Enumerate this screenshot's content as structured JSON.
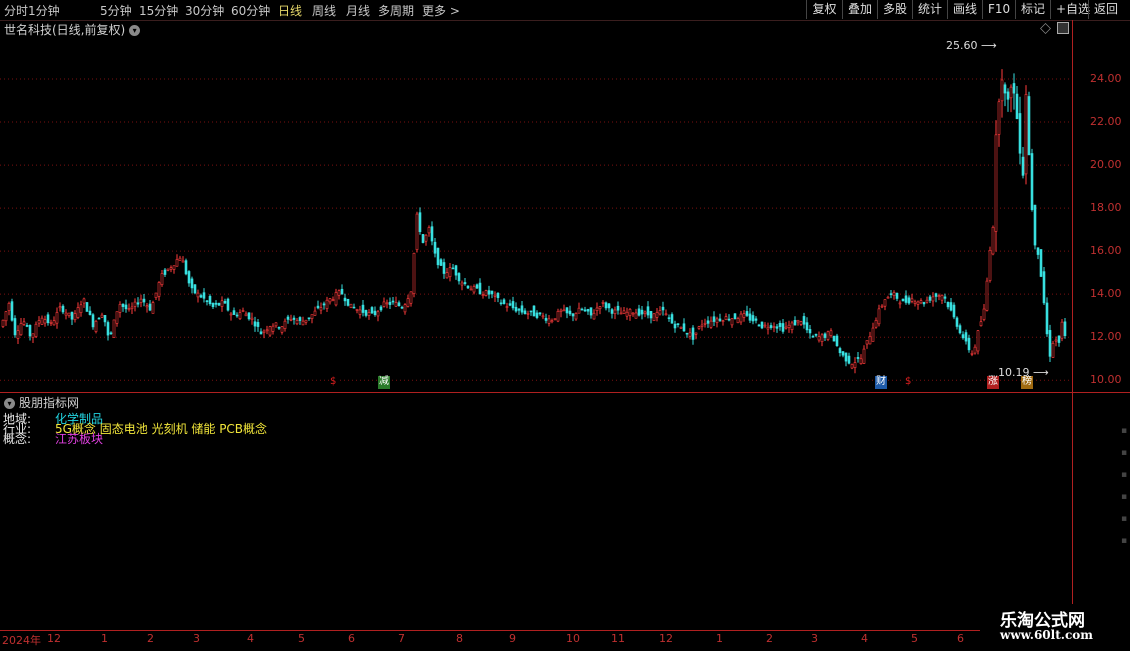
{
  "toolbar": {
    "periods": [
      "分时",
      "1分钟",
      "5分钟",
      "15分钟",
      "30分钟",
      "60分钟",
      "日线",
      "周线",
      "月线",
      "多周期",
      "更多 >"
    ],
    "active_period": "日线",
    "right_buttons": [
      "复权",
      "叠加",
      "多股",
      "统计",
      "画线",
      "F10",
      "标记",
      "+自选",
      "返回"
    ]
  },
  "main_chart": {
    "title": "世名科技(日线,前复权)",
    "high_label": "25.60",
    "low_label": "10.19"
  },
  "sub_panel": {
    "title": "股朋指标网",
    "rows": [
      {
        "label": "地域:",
        "value": "化学制品",
        "color": "#22d4e0"
      },
      {
        "label": "行业:",
        "value": "5G概念 固态电池 光刻机 储能 PCB概念",
        "color": "#f2e63a"
      },
      {
        "label": "概念:",
        "value": "江苏板块",
        "color": "#e040e0"
      }
    ]
  },
  "y_axis": {
    "ticks": [
      "24.00",
      "22.00",
      "20.00",
      "18.00",
      "16.00",
      "14.00",
      "12.00",
      "10.00"
    ]
  },
  "date_axis": {
    "labels": [
      "2024年",
      "12",
      "1",
      "2",
      "3",
      "4",
      "5",
      "6",
      "7",
      "8",
      "9",
      "10",
      "11",
      "12",
      "1",
      "2",
      "3",
      "4",
      "5",
      "6"
    ]
  },
  "markers": [
    {
      "text": "$",
      "bg": "#000000",
      "fg": "#e02020"
    },
    {
      "text": "减",
      "bg": "#2a7a2a",
      "fg": "#ffffff"
    },
    {
      "text": "财",
      "bg": "#1e5aa8",
      "fg": "#ffffff"
    },
    {
      "text": "$",
      "bg": "#000000",
      "fg": "#e02020"
    },
    {
      "text": "涨",
      "bg": "#b02020",
      "fg": "#ffffff"
    },
    {
      "text": "榜",
      "bg": "#a06a10",
      "fg": "#ffffff"
    }
  ],
  "watermark": {
    "title": "乐淘公式网",
    "url": "www.60lt.com"
  },
  "colors": {
    "up": "#ff3c3c",
    "down": "#38e0e0",
    "grid": "#7a1010",
    "axis": "#b02020"
  },
  "chart_data": {
    "type": "candlestick",
    "ylim": [
      9.5,
      26.0
    ],
    "y_ticks": [
      10,
      12,
      14,
      16,
      18,
      20,
      22,
      24
    ],
    "high": 25.6,
    "low": 10.19,
    "path": [
      [
        0,
        12.5
      ],
      [
        8,
        13.6
      ],
      [
        14,
        12.2
      ],
      [
        22,
        12.8
      ],
      [
        30,
        12.0
      ],
      [
        40,
        13.0
      ],
      [
        50,
        12.6
      ],
      [
        60,
        13.4
      ],
      [
        72,
        12.8
      ],
      [
        82,
        13.8
      ],
      [
        92,
        12.6
      ],
      [
        102,
        13.2
      ],
      [
        108,
        11.8
      ],
      [
        118,
        13.6
      ],
      [
        128,
        13.2
      ],
      [
        140,
        13.8
      ],
      [
        150,
        13.3
      ],
      [
        160,
        14.8
      ],
      [
        172,
        15.4
      ],
      [
        180,
        15.8
      ],
      [
        190,
        14.2
      ],
      [
        200,
        13.9
      ],
      [
        212,
        13.4
      ],
      [
        222,
        13.6
      ],
      [
        232,
        13.0
      ],
      [
        242,
        13.2
      ],
      [
        252,
        12.8
      ],
      [
        260,
        12.2
      ],
      [
        270,
        12.6
      ],
      [
        280,
        12.5
      ],
      [
        290,
        12.9
      ],
      [
        300,
        12.7
      ],
      [
        310,
        13.0
      ],
      [
        320,
        13.4
      ],
      [
        330,
        13.8
      ],
      [
        340,
        14.1
      ],
      [
        350,
        13.4
      ],
      [
        362,
        13.2
      ],
      [
        372,
        13.0
      ],
      [
        382,
        13.5
      ],
      [
        392,
        13.6
      ],
      [
        402,
        13.4
      ],
      [
        410,
        14.2
      ],
      [
        416,
        17.6
      ],
      [
        422,
        16.4
      ],
      [
        428,
        17.0
      ],
      [
        434,
        15.8
      ],
      [
        442,
        15.0
      ],
      [
        452,
        15.2
      ],
      [
        460,
        14.6
      ],
      [
        470,
        14.3
      ],
      [
        480,
        14.1
      ],
      [
        490,
        14.0
      ],
      [
        500,
        13.6
      ],
      [
        510,
        13.4
      ],
      [
        520,
        13.2
      ],
      [
        530,
        13.1
      ],
      [
        540,
        13.0
      ],
      [
        550,
        12.8
      ],
      [
        560,
        13.2
      ],
      [
        570,
        13.0
      ],
      [
        580,
        13.3
      ],
      [
        590,
        13.0
      ],
      [
        600,
        13.6
      ],
      [
        612,
        13.2
      ],
      [
        622,
        13.1
      ],
      [
        632,
        13.2
      ],
      [
        642,
        13.1
      ],
      [
        652,
        13.0
      ],
      [
        662,
        13.2
      ],
      [
        672,
        12.6
      ],
      [
        682,
        12.4
      ],
      [
        692,
        12.0
      ],
      [
        702,
        12.7
      ],
      [
        712,
        12.8
      ],
      [
        722,
        12.9
      ],
      [
        732,
        12.9
      ],
      [
        742,
        13.0
      ],
      [
        752,
        12.8
      ],
      [
        762,
        12.5
      ],
      [
        772,
        12.6
      ],
      [
        782,
        12.4
      ],
      [
        792,
        12.6
      ],
      [
        800,
        12.8
      ],
      [
        810,
        12.0
      ],
      [
        820,
        12.0
      ],
      [
        830,
        12.2
      ],
      [
        840,
        11.2
      ],
      [
        850,
        10.8
      ],
      [
        860,
        11.0
      ],
      [
        868,
        12.0
      ],
      [
        876,
        13.0
      ],
      [
        884,
        13.8
      ],
      [
        892,
        14.0
      ],
      [
        902,
        13.6
      ],
      [
        912,
        13.8
      ],
      [
        922,
        13.6
      ],
      [
        932,
        13.9
      ],
      [
        942,
        14.0
      ],
      [
        950,
        13.2
      ],
      [
        958,
        12.4
      ],
      [
        966,
        11.6
      ],
      [
        972,
        11.2
      ],
      [
        978,
        12.4
      ],
      [
        984,
        13.4
      ],
      [
        988,
        15.8
      ],
      [
        992,
        17.2
      ],
      [
        995,
        21.0
      ],
      [
        998,
        23.4
      ],
      [
        1000,
        24.8
      ],
      [
        1003,
        23.6
      ],
      [
        1006,
        22.2
      ],
      [
        1010,
        24.0
      ],
      [
        1014,
        23.0
      ],
      [
        1018,
        21.4
      ],
      [
        1022,
        19.8
      ],
      [
        1025,
        23.5
      ],
      [
        1028,
        20.5
      ],
      [
        1031,
        18.0
      ],
      [
        1034,
        16.4
      ],
      [
        1038,
        15.8
      ],
      [
        1041,
        14.4
      ],
      [
        1044,
        13.2
      ],
      [
        1047,
        11.6
      ],
      [
        1050,
        11.0
      ],
      [
        1053,
        12.2
      ],
      [
        1057,
        11.5
      ],
      [
        1061,
        12.6
      ],
      [
        1065,
        11.8
      ]
    ]
  }
}
